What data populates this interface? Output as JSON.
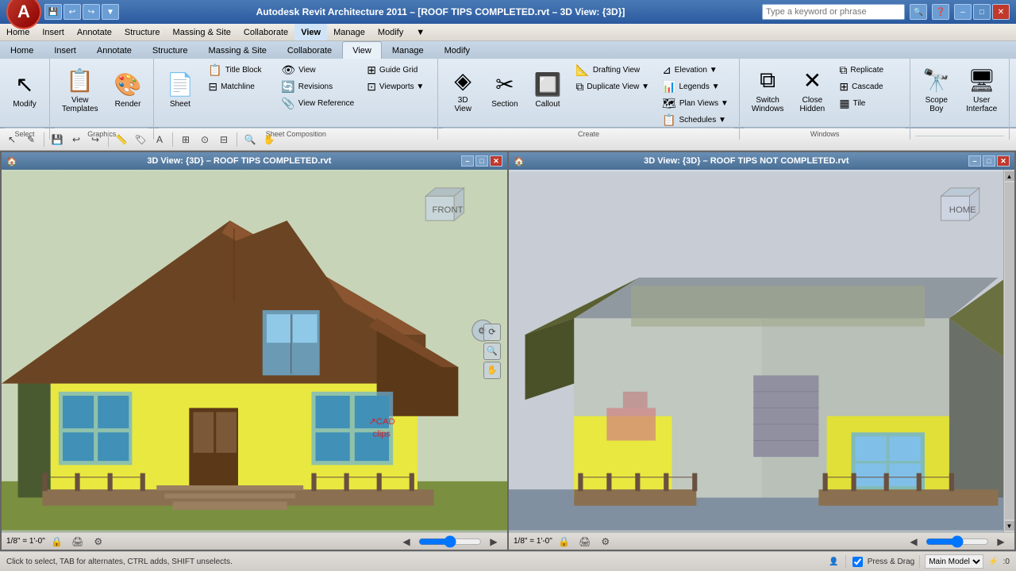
{
  "title_bar": {
    "text": "Autodesk Revit Architecture 2011 – [ROOF TIPS COMPLETED.rvt – 3D View: {3D}]",
    "search_placeholder": "Type a keyword or phrase",
    "btn_min": "–",
    "btn_max": "□",
    "btn_close": "✕"
  },
  "menu": {
    "items": [
      "Home",
      "Insert",
      "Annotate",
      "Structure",
      "Massing & Site",
      "Collaborate",
      "View",
      "Manage",
      "Modify"
    ]
  },
  "ribbon": {
    "active_tab": "View",
    "groups": [
      {
        "label": "Select",
        "buttons_big": [
          {
            "id": "modify",
            "icon": "↖",
            "label": "Modify"
          },
          {
            "id": "view-templates",
            "icon": "📋",
            "label": "View\nTemplates"
          },
          {
            "id": "render",
            "icon": "🎨",
            "label": "Render"
          }
        ]
      },
      {
        "label": "Graphics",
        "buttons_small": []
      },
      {
        "label": "Sheet Composition",
        "buttons": [
          {
            "id": "sheet",
            "icon": "📄",
            "label": "Sheet"
          },
          {
            "id": "title-block",
            "icon": "📋",
            "label": "Title Block"
          },
          {
            "id": "matchline",
            "icon": "⊟",
            "label": "Matchline"
          },
          {
            "id": "view-btn",
            "icon": "👁",
            "label": "View"
          },
          {
            "id": "revisions",
            "icon": "🔄",
            "label": "Revisions"
          },
          {
            "id": "view-reference",
            "icon": "📎",
            "label": "View Reference"
          },
          {
            "id": "guide-grid",
            "icon": "⊞",
            "label": "Guide Grid"
          },
          {
            "id": "viewports",
            "icon": "⊡",
            "label": "Viewports"
          }
        ]
      },
      {
        "label": "Create",
        "buttons": [
          {
            "id": "3d-view",
            "icon": "◈",
            "label": "3D View"
          },
          {
            "id": "section",
            "icon": "✂",
            "label": "Section"
          },
          {
            "id": "callout",
            "icon": "🔲",
            "label": "Callout"
          },
          {
            "id": "drafting-view",
            "icon": "📐",
            "label": "Drafting View"
          },
          {
            "id": "duplicate-view",
            "icon": "⧉",
            "label": "Duplicate View"
          },
          {
            "id": "elevation",
            "icon": "⊿",
            "label": "Elevation"
          },
          {
            "id": "legends",
            "icon": "📊",
            "label": "Legends"
          },
          {
            "id": "plan-views",
            "icon": "🗺",
            "label": "Plan Views"
          },
          {
            "id": "schedules",
            "icon": "📋",
            "label": "Schedules"
          }
        ]
      },
      {
        "label": "Windows",
        "buttons": [
          {
            "id": "switch-windows",
            "icon": "⧉",
            "label": "Switch Windows"
          },
          {
            "id": "close-hidden",
            "icon": "✕",
            "label": "Close Hidden"
          },
          {
            "id": "replicate",
            "icon": "⧉",
            "label": "Replicate"
          },
          {
            "id": "cascade",
            "icon": "⊞",
            "label": "Cascade"
          },
          {
            "id": "tile",
            "icon": "▦",
            "label": "Tile"
          }
        ]
      },
      {
        "label": "",
        "buttons": [
          {
            "id": "scope-boy",
            "icon": "🔭",
            "label": "Scope Boy"
          },
          {
            "id": "user-interface",
            "icon": "🖥",
            "label": "User Interface"
          }
        ]
      }
    ]
  },
  "toolbar": {
    "tools": [
      "✎",
      "💾",
      "↩",
      "↪",
      "✂",
      "📋",
      "🔍",
      "A"
    ]
  },
  "viewports": [
    {
      "id": "left-viewport",
      "title": "3D View: {3D} – ROOF TIPS COMPLETED.rvt",
      "scale": "1/8\" = 1'-0\"",
      "model": ""
    },
    {
      "id": "right-viewport",
      "title": "3D View: {3D} – ROOF TIPS NOT COMPLETED.rvt",
      "scale": "1/8\" = 1'-0\"",
      "model": "Main Model"
    }
  ],
  "status_bar": {
    "message": "Click to select, TAB for alternates, CTRL adds, SHIFT unselects.",
    "scale_lock": "🔒",
    "model_label": "Main Model",
    "filter_icon": "⚡",
    "filter_count": ":0",
    "press_drag": "Press & Drag"
  }
}
